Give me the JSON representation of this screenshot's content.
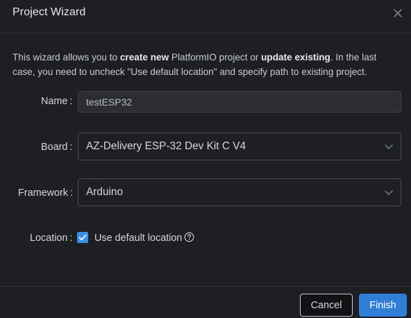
{
  "dialog": {
    "title": "Project Wizard"
  },
  "description": {
    "part1": "This wizard allows you to ",
    "bold1": "create new",
    "part2": " PlatformIO project or ",
    "bold2": "update existing",
    "part3": ". In the last case, you need to uncheck \"Use default location\" and specify path to existing project."
  },
  "form": {
    "name_label": "Name",
    "name_value": "testESP32",
    "board_label": "Board",
    "board_value": "AZ-Delivery ESP-32 Dev Kit C V4",
    "framework_label": "Framework",
    "framework_value": "Arduino",
    "location_label": "Location",
    "use_default_location_label": "Use default location",
    "use_default_location_checked": true,
    "colon": ":"
  },
  "footer": {
    "cancel_label": "Cancel",
    "finish_label": "Finish"
  },
  "colors": {
    "accent": "#2f7fd6",
    "checkbox": "#3a8ee6",
    "background": "#1e1f22"
  },
  "icons": {
    "close": "close-icon",
    "chevron": "chevron-down-icon",
    "check": "check-icon",
    "help": "question-circle-icon"
  }
}
